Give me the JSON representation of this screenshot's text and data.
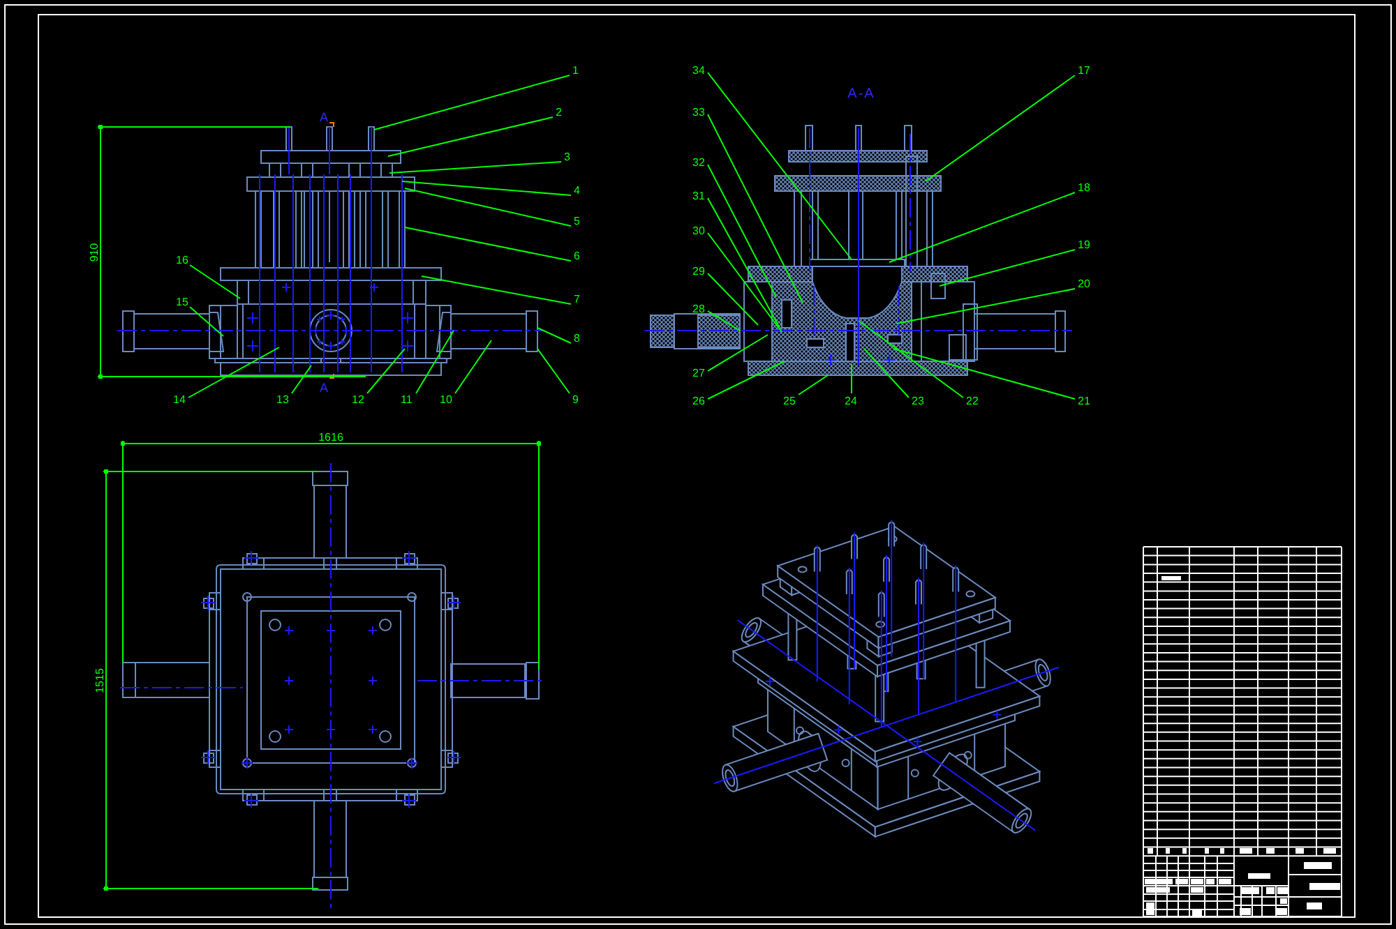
{
  "drawing_sheet": {
    "front_view": {
      "section_marks": [
        "A",
        "A"
      ],
      "height_dimension": "910",
      "right_part_numbers": [
        "1",
        "2",
        "3",
        "4",
        "5",
        "6",
        "7",
        "8"
      ],
      "left_part_numbers": [
        "16",
        "15"
      ],
      "bottom_part_numbers": [
        "14",
        "13",
        "12",
        "11",
        "10",
        "9"
      ]
    },
    "section_view": {
      "title": "A-A",
      "left_part_numbers": [
        "34",
        "33",
        "32",
        "31",
        "30",
        "29",
        "28",
        "27"
      ],
      "right_part_numbers": [
        "17",
        "18",
        "19",
        "20"
      ],
      "bottom_part_numbers": [
        "26",
        "25",
        "24",
        "23",
        "22",
        "21"
      ]
    },
    "top_view": {
      "width_dimension": "1616",
      "height_dimension": "1515"
    }
  }
}
